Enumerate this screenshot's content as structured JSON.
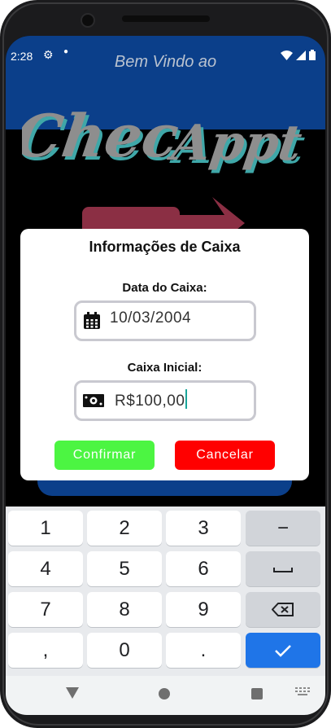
{
  "status_bar": {
    "time": "2:28",
    "icons": [
      "gear-icon",
      "dot-icon",
      "wifi-icon",
      "signal-icon",
      "battery-icon"
    ]
  },
  "hero": {
    "welcome_text": "Bem Vindo ao",
    "logo_text": "CheckAppt"
  },
  "dialog": {
    "title": "Informações de Caixa",
    "date_label": "Data do Caixa:",
    "date_value": "10/03/2004",
    "cash_label": "Caixa Inicial:",
    "cash_value": "R$100,00",
    "confirm_label": "Confirmar",
    "cancel_label": "Cancelar"
  },
  "keyboard": {
    "rows": [
      [
        "1",
        "2",
        "3",
        "−"
      ],
      [
        "4",
        "5",
        "6",
        "space"
      ],
      [
        "7",
        "8",
        "9",
        "backspace"
      ],
      [
        ",",
        "0",
        ".",
        "done"
      ]
    ]
  },
  "colors": {
    "hero_blue": "#0b3f8a",
    "confirm_green": "#4cf542",
    "cancel_red": "#ff0000",
    "keyboard_accent": "#1f75e8",
    "caret_teal": "#19a59a"
  }
}
